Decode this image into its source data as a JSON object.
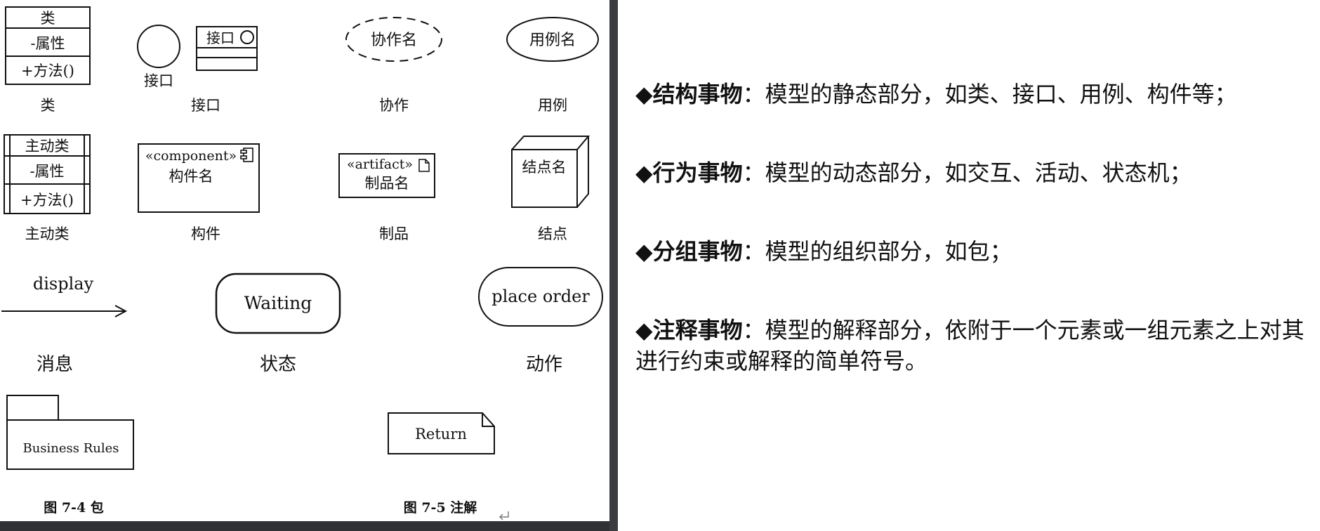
{
  "diagram": {
    "class_box": {
      "name": "类",
      "attr": "-属性",
      "method": "+方法()",
      "caption": "类"
    },
    "interface": {
      "lollipop_label": "接口",
      "box_label": "接口",
      "caption": "接口"
    },
    "collaboration": {
      "label": "协作名",
      "caption": "协作"
    },
    "usecase": {
      "label": "用例名",
      "caption": "用例"
    },
    "active_class": {
      "name": "主动类",
      "attr": "-属性",
      "method": "+方法()",
      "caption": "主动类"
    },
    "component": {
      "stereotype": "«component»",
      "name": "构件名",
      "caption": "构件"
    },
    "artifact": {
      "stereotype": "«artifact»",
      "name": "制品名",
      "caption": "制品"
    },
    "node": {
      "label": "结点名",
      "caption": "结点"
    },
    "message": {
      "label": "display",
      "caption": "消息"
    },
    "state": {
      "label": "Waiting",
      "caption": "状态"
    },
    "action": {
      "label": "place order",
      "caption": "动作"
    },
    "package": {
      "label": "Business Rules",
      "caption": "图  7-4  包"
    },
    "note": {
      "label": "Return",
      "caption": "图  7-5  注解"
    }
  },
  "notes": [
    {
      "bullet": "◆",
      "term": "结构事物",
      "text": "：模型的静态部分，如类、接口、用例、构件等；"
    },
    {
      "bullet": "◆",
      "term": "行为事物",
      "text": "：模型的动态部分，如交互、活动、状态机；"
    },
    {
      "bullet": "◆",
      "term": "分组事物",
      "text": "：模型的组织部分，如包；"
    },
    {
      "bullet": "◆",
      "term": "注释事物",
      "text": "：模型的解释部分，依附于一个元素或一组元素之上对其进行约束或解释的简单符号。"
    }
  ]
}
